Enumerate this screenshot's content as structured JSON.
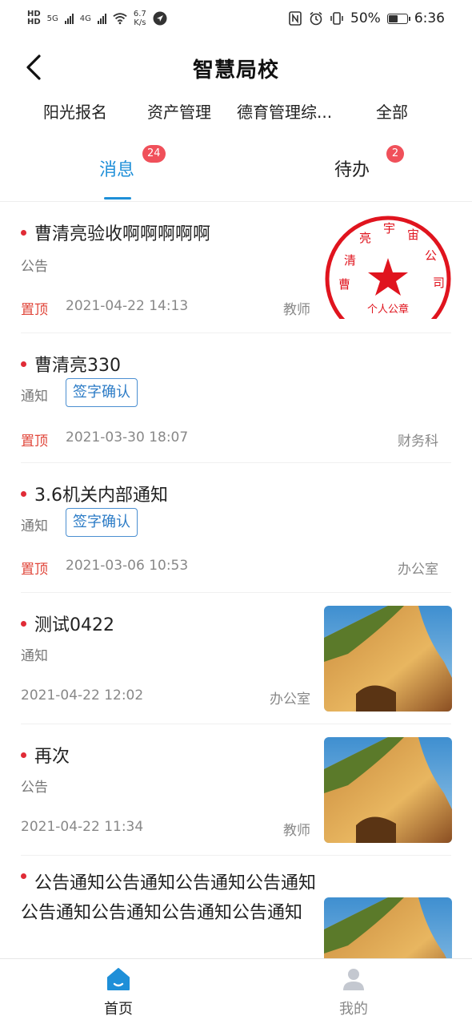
{
  "status_bar": {
    "hd1": "HD",
    "hd2": "HD",
    "net1": "5G",
    "net2": "4G",
    "speed_value": "6.7",
    "speed_unit": "K/s",
    "battery_percent": "50%",
    "battery_level": 0.5,
    "time": "6:36"
  },
  "header": {
    "title": "智慧局校"
  },
  "categories": [
    "阳光报名",
    "资产管理",
    "德育管理综...",
    "全部"
  ],
  "tabs": [
    {
      "label": "消息",
      "badge": "24",
      "active": true
    },
    {
      "label": "待办",
      "badge": "2",
      "active": false
    }
  ],
  "messages": [
    {
      "title": "曹清亮验收啊啊啊啊啊",
      "type": "公告",
      "pinned": "置顶",
      "time": "2021-04-22 14:13",
      "dept": "教师",
      "thumb": "seal-image",
      "seal_text_top": "曹清亮宇宙公司",
      "seal_text_bottom": "个人公章"
    },
    {
      "title": "曹清亮330",
      "type": "通知",
      "tag": "签字确认",
      "pinned": "置顶",
      "time": "2021-03-30 18:07",
      "dept": "财务科"
    },
    {
      "title": "3.6机关内部通知",
      "type": "通知",
      "tag": "签字确认",
      "pinned": "置顶",
      "time": "2021-03-06 10:53",
      "dept": "办公室"
    },
    {
      "title": "测试0422",
      "type": "通知",
      "time": "2021-04-22 12:02",
      "dept": "办公室",
      "thumb": "rock-landscape-image"
    },
    {
      "title": "再次",
      "type": "公告",
      "time": "2021-04-22 11:34",
      "dept": "教师",
      "thumb": "rock-landscape-image"
    },
    {
      "title": "公告通知公告通知公告通知公告通知公告通知公告通知公告通知公告通知",
      "thumb": "rock-landscape-image"
    }
  ],
  "bottom_nav": [
    {
      "label": "首页",
      "icon": "home-icon",
      "active": true
    },
    {
      "label": "我的",
      "icon": "user-icon",
      "active": false
    }
  ],
  "colors": {
    "accent": "#1e8fd8",
    "badge": "#f0505a",
    "pin": "#e0463a",
    "unread_dot": "#e02b36",
    "tag_border": "#4b8fd1"
  }
}
